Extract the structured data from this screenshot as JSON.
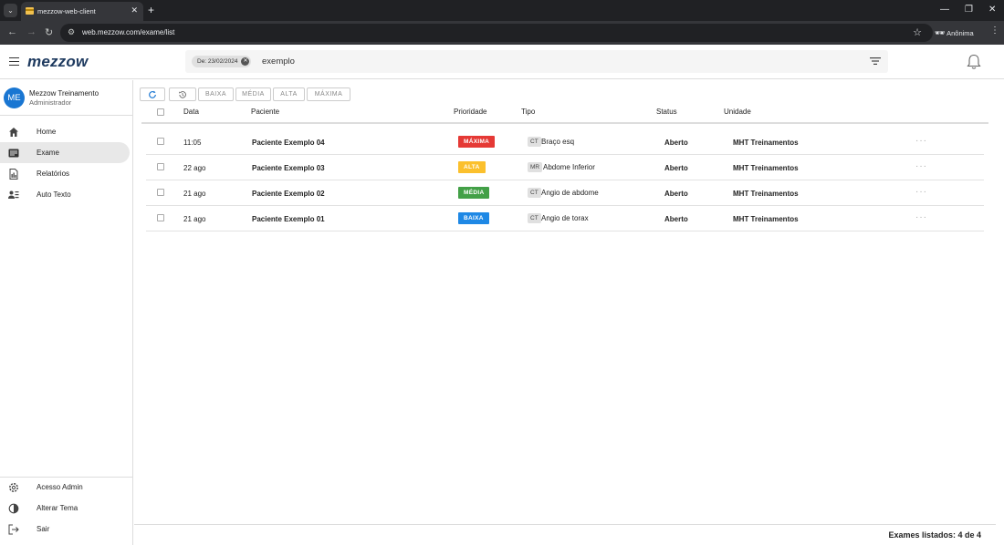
{
  "browser": {
    "tab_title": "mezzow-web-client",
    "tab_close": "✕",
    "new_tab": "+",
    "url": "web.mezzow.com/exame/list",
    "profile_label": "Anônima"
  },
  "app": {
    "logo": "mezzow",
    "search": {
      "chip_label": "De: 23/02/2024",
      "query": "exemplo"
    }
  },
  "sidebar": {
    "user": {
      "initials": "ME",
      "name": "Mezzow Treinamento",
      "role": "Administrador"
    },
    "items": [
      {
        "label": "Home",
        "icon": "home-icon"
      },
      {
        "label": "Exame",
        "icon": "list-icon",
        "active": true
      },
      {
        "label": "Relatórios",
        "icon": "report-icon"
      },
      {
        "label": "Auto Texto",
        "icon": "auto-text-icon"
      }
    ],
    "bottom_items": [
      {
        "label": "Acesso Admin",
        "icon": "gear-icon"
      },
      {
        "label": "Alterar Tema",
        "icon": "theme-icon"
      },
      {
        "label": "Sair",
        "icon": "logout-icon"
      }
    ]
  },
  "toolbar": {
    "filters": [
      "BAIXA",
      "MÉDIA",
      "ALTA",
      "MÁXIMA"
    ]
  },
  "table": {
    "headers": {
      "data": "Data",
      "paciente": "Paciente",
      "prioridade": "Prioridade",
      "tipo": "Tipo",
      "status": "Status",
      "unidade": "Unidade"
    },
    "rows": [
      {
        "data": "11:05",
        "paciente": "Paciente Exemplo 04",
        "prioridade": "MÁXIMA",
        "prio_color": "#e53935",
        "modalidade": "CT",
        "tipo": "Braço esq",
        "status": "Aberto",
        "unidade": "MHT Treinamentos"
      },
      {
        "data": "22 ago",
        "paciente": "Paciente Exemplo 03",
        "prioridade": "ALTA",
        "prio_color": "#fbc02d",
        "modalidade": "MR",
        "tipo": "Abdome Inferior",
        "status": "Aberto",
        "unidade": "MHT Treinamentos"
      },
      {
        "data": "21 ago",
        "paciente": "Paciente Exemplo 02",
        "prioridade": "MÉDIA",
        "prio_color": "#43a047",
        "modalidade": "CT",
        "tipo": "Angio de abdome",
        "status": "Aberto",
        "unidade": "MHT Treinamentos"
      },
      {
        "data": "21 ago",
        "paciente": "Paciente Exemplo 01",
        "prioridade": "BAIXA",
        "prio_color": "#1e88e5",
        "modalidade": "CT",
        "tipo": "Angio de torax",
        "status": "Aberto",
        "unidade": "MHT Treinamentos"
      }
    ]
  },
  "footer": {
    "text": "Exames listados: 4 de 4"
  }
}
